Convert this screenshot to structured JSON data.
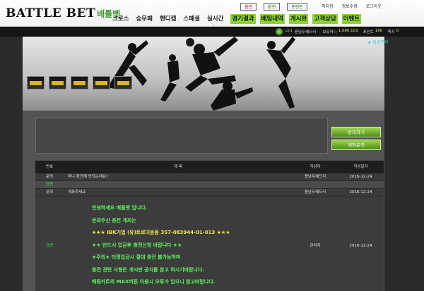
{
  "header": {
    "logo_main": "BATTLE BET",
    "logo_sub": "배틀벳",
    "small_buttons": [
      "충전",
      "환전",
      "포인트"
    ],
    "account_links": [
      "쪽지함",
      "정보수정",
      "로그아웃"
    ],
    "nav": [
      "크로스",
      "승무패",
      "핸디캡",
      "스페셜",
      "실시간",
      "경기결과",
      "베팅내역",
      "게시판",
      "고객상담",
      "이벤트"
    ],
    "nav_highlighted": "경기결과"
  },
  "userbar": {
    "level": "LV.1",
    "username": "용남두혜드리",
    "money_label": "보유머니",
    "money": "1,080,103",
    "point_label": "포인트",
    "point": "100",
    "note_label": "쪽지",
    "note": "0"
  },
  "banner": {
    "chat_link": "★ 입금문의"
  },
  "side_buttons": {
    "inquiry": "문의하기",
    "account_inquiry": "계좌문의"
  },
  "table": {
    "headers": {
      "type": "번호",
      "title": "제 목",
      "writer": "작성자",
      "date": "작성일자"
    },
    "rows": [
      {
        "type": "문의",
        "title": "머니 환전해 안되는데요?",
        "writer": "용남두혜드리",
        "date": "2016-12-24"
      },
      {
        "type": "답변",
        "title": "",
        "writer": "",
        "date": ""
      },
      {
        "type": "문의",
        "title": "계좌주세요",
        "writer": "용남두혜드리",
        "date": "2016-12-24"
      }
    ],
    "answer": {
      "type": "답변",
      "writer": "관리자",
      "date": "2016-12-24",
      "lines": [
        "안녕하세요 배틀벳 입니다.",
        "문의주신 충전 계좌는",
        "★★★ IBK기업 (유)트로이윤동 357-083944-01-013 ★★★",
        "★★ 반드시 입금후 충전신청 바랍니다 ★★",
        "★주의★ 타명입금시 절대 충전 불가능하며",
        "충전 관련 사항은 게시판 공지를 참고 하시기바랍니다.",
        "베팅카트의 MAX버튼 이용시 오류가 있으니 참고바랍니다."
      ]
    }
  },
  "colors": {
    "accent_green": "#8ed235",
    "answer_text": "#5ef35e",
    "answer_highlight": "#f3e84a",
    "chat_link": "#2ec9c0"
  }
}
